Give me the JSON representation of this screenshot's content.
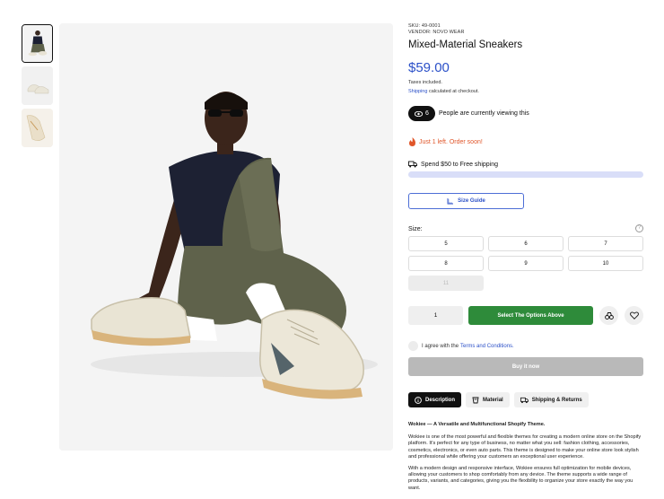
{
  "thumbnails": [
    {
      "name": "seated-model",
      "active": true
    },
    {
      "name": "sneaker-pair",
      "active": false
    },
    {
      "name": "sneaker-detail",
      "active": false
    }
  ],
  "product": {
    "sku": "SKU: 49-0001",
    "vendor": "VENDOR: NOVO WEAR",
    "title": "Mixed-Material Sneakers",
    "price": "$59.00",
    "tax_note": "Taxes included.",
    "shipping_link": "Shipping",
    "shipping_rest": " calculated at checkout.",
    "price_color": "#2b50c8"
  },
  "viewers": {
    "count": "6",
    "text": "People are currently viewing this"
  },
  "stock": {
    "text": "Just 1 left. Order soon!",
    "color": "#e0562a"
  },
  "free_shipping": {
    "text": "Spend $50 to Free shipping",
    "progress_color": "#d9def8"
  },
  "size_guide": {
    "label": "Size Guide"
  },
  "size": {
    "label": "Size:",
    "help_icon": "?",
    "options": [
      "5",
      "6",
      "7",
      "8",
      "9",
      "10",
      "11"
    ],
    "disabled": [
      "11"
    ]
  },
  "purchase": {
    "quantity": "1",
    "add_label": "Select The Options Above",
    "add_color": "#2e8b3a",
    "compare_icon": "compare-icon",
    "wishlist_icon": "heart-icon"
  },
  "terms": {
    "prefix": "I agree with the",
    "link": "Terms and Conditions."
  },
  "buy_now": {
    "label": "Buy it now"
  },
  "tabs": [
    {
      "label": "Description",
      "icon": "info-icon",
      "active": true
    },
    {
      "label": "Material",
      "icon": "fabric-icon",
      "active": false
    },
    {
      "label": "Shipping & Returns",
      "icon": "truck-icon",
      "active": false
    }
  ],
  "description": {
    "heading": "Wokiee — A Versatile and Multifunctional Shopify Theme.",
    "para1": "Wokiee is one of the most powerful and flexible themes for creating a modern online store on the Shopify platform. It's perfect for any type of business, no matter what you sell: fashion clothing, accessories, cosmetics, electronics, or even auto parts. This theme is designed to make your online store look stylish and professional while offering your customers an exceptional user experience.",
    "para2": "With a modern design and responsive interface, Wokiee ensures full optimization for mobile devices, allowing your customers to shop comfortably from any device. The theme supports a wide range of products, variants, and categories, giving you the flexibility to organize your store exactly the way you want."
  }
}
